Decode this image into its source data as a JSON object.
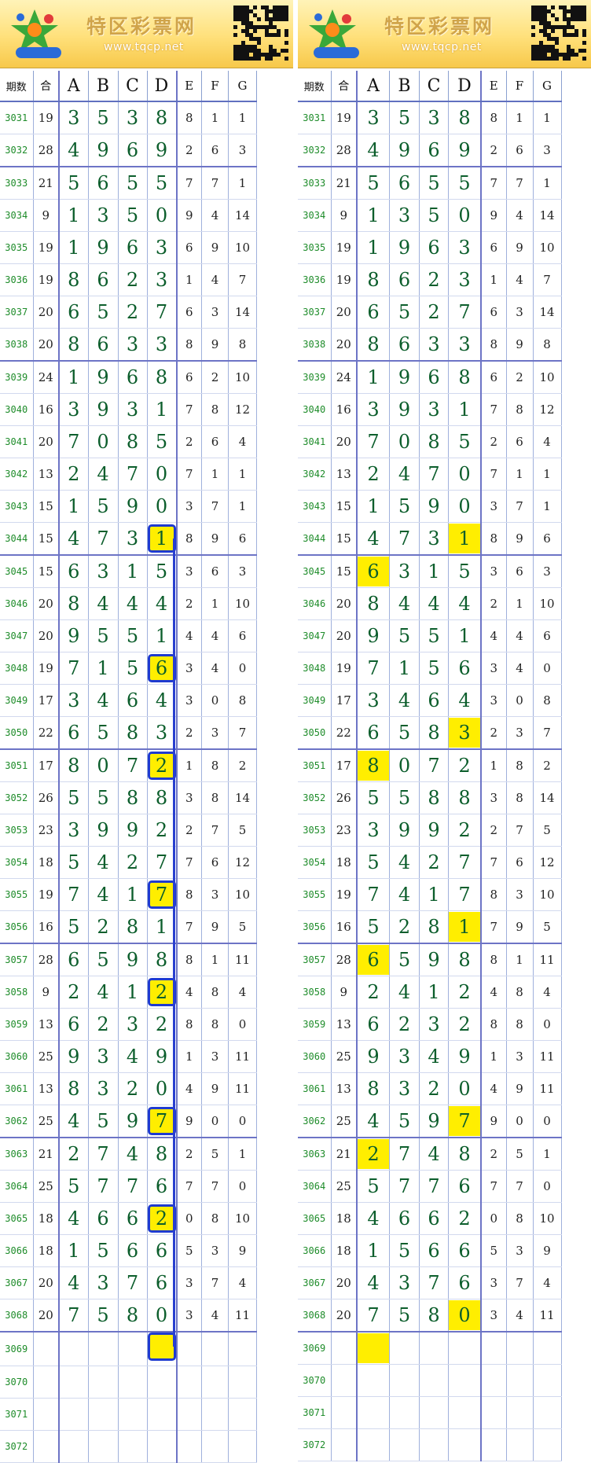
{
  "banner": {
    "brand": "特区彩票网",
    "url": "www.tqcp.net",
    "logo_icon": "seven-star-lottery-logo",
    "qr_icon": "qr-code-icon"
  },
  "headers": [
    "期数",
    "合",
    "A",
    "B",
    "C",
    "D",
    "E",
    "F",
    "G"
  ],
  "colors": {
    "highlight": "#ffee00",
    "highlight_border": "#1f3bd0",
    "digit": "#0c5e2c",
    "issue": "#1e8c2a",
    "grid": "#6d74c6"
  },
  "rows": [
    {
      "issue": "3031",
      "s": "19",
      "a": "3",
      "b": "5",
      "c": "3",
      "d": "8",
      "e": "8",
      "f": "1",
      "g": "1"
    },
    {
      "issue": "3032",
      "s": "28",
      "a": "4",
      "b": "9",
      "c": "6",
      "d": "9",
      "e": "2",
      "f": "6",
      "g": "3"
    },
    {
      "issue": "3033",
      "s": "21",
      "a": "5",
      "b": "6",
      "c": "5",
      "d": "5",
      "e": "7",
      "f": "7",
      "g": "1"
    },
    {
      "issue": "3034",
      "s": "9",
      "a": "1",
      "b": "3",
      "c": "5",
      "d": "0",
      "e": "9",
      "f": "4",
      "g": "14"
    },
    {
      "issue": "3035",
      "s": "19",
      "a": "1",
      "b": "9",
      "c": "6",
      "d": "3",
      "e": "6",
      "f": "9",
      "g": "10"
    },
    {
      "issue": "3036",
      "s": "19",
      "a": "8",
      "b": "6",
      "c": "2",
      "d": "3",
      "e": "1",
      "f": "4",
      "g": "7"
    },
    {
      "issue": "3037",
      "s": "20",
      "a": "6",
      "b": "5",
      "c": "2",
      "d": "7",
      "e": "6",
      "f": "3",
      "g": "14"
    },
    {
      "issue": "3038",
      "s": "20",
      "a": "8",
      "b": "6",
      "c": "3",
      "d": "3",
      "e": "8",
      "f": "9",
      "g": "8"
    },
    {
      "issue": "3039",
      "s": "24",
      "a": "1",
      "b": "9",
      "c": "6",
      "d": "8",
      "e": "6",
      "f": "2",
      "g": "10"
    },
    {
      "issue": "3040",
      "s": "16",
      "a": "3",
      "b": "9",
      "c": "3",
      "d": "1",
      "e": "7",
      "f": "8",
      "g": "12"
    },
    {
      "issue": "3041",
      "s": "20",
      "a": "7",
      "b": "0",
      "c": "8",
      "d": "5",
      "e": "2",
      "f": "6",
      "g": "4"
    },
    {
      "issue": "3042",
      "s": "13",
      "a": "2",
      "b": "4",
      "c": "7",
      "d": "0",
      "e": "7",
      "f": "1",
      "g": "1"
    },
    {
      "issue": "3043",
      "s": "15",
      "a": "1",
      "b": "5",
      "c": "9",
      "d": "0",
      "e": "3",
      "f": "7",
      "g": "1"
    },
    {
      "issue": "3044",
      "s": "15",
      "a": "4",
      "b": "7",
      "c": "3",
      "d": "1",
      "e": "8",
      "f": "9",
      "g": "6"
    },
    {
      "issue": "3045",
      "s": "15",
      "a": "6",
      "b": "3",
      "c": "1",
      "d": "5",
      "e": "3",
      "f": "6",
      "g": "3"
    },
    {
      "issue": "3046",
      "s": "20",
      "a": "8",
      "b": "4",
      "c": "4",
      "d": "4",
      "e": "2",
      "f": "1",
      "g": "10"
    },
    {
      "issue": "3047",
      "s": "20",
      "a": "9",
      "b": "5",
      "c": "5",
      "d": "1",
      "e": "4",
      "f": "4",
      "g": "6"
    },
    {
      "issue": "3048",
      "s": "19",
      "a": "7",
      "b": "1",
      "c": "5",
      "d": "6",
      "e": "3",
      "f": "4",
      "g": "0"
    },
    {
      "issue": "3049",
      "s": "17",
      "a": "3",
      "b": "4",
      "c": "6",
      "d": "4",
      "e": "3",
      "f": "0",
      "g": "8"
    },
    {
      "issue": "3050",
      "s": "22",
      "a": "6",
      "b": "5",
      "c": "8",
      "d": "3",
      "e": "2",
      "f": "3",
      "g": "7"
    },
    {
      "issue": "3051",
      "s": "17",
      "a": "8",
      "b": "0",
      "c": "7",
      "d": "2",
      "e": "1",
      "f": "8",
      "g": "2"
    },
    {
      "issue": "3052",
      "s": "26",
      "a": "5",
      "b": "5",
      "c": "8",
      "d": "8",
      "e": "3",
      "f": "8",
      "g": "14"
    },
    {
      "issue": "3053",
      "s": "23",
      "a": "3",
      "b": "9",
      "c": "9",
      "d": "2",
      "e": "2",
      "f": "7",
      "g": "5"
    },
    {
      "issue": "3054",
      "s": "18",
      "a": "5",
      "b": "4",
      "c": "2",
      "d": "7",
      "e": "7",
      "f": "6",
      "g": "12"
    },
    {
      "issue": "3055",
      "s": "19",
      "a": "7",
      "b": "4",
      "c": "1",
      "d": "7",
      "e": "8",
      "f": "3",
      "g": "10"
    },
    {
      "issue": "3056",
      "s": "16",
      "a": "5",
      "b": "2",
      "c": "8",
      "d": "1",
      "e": "7",
      "f": "9",
      "g": "5"
    },
    {
      "issue": "3057",
      "s": "28",
      "a": "6",
      "b": "5",
      "c": "9",
      "d": "8",
      "e": "8",
      "f": "1",
      "g": "11"
    },
    {
      "issue": "3058",
      "s": "9",
      "a": "2",
      "b": "4",
      "c": "1",
      "d": "2",
      "e": "4",
      "f": "8",
      "g": "4"
    },
    {
      "issue": "3059",
      "s": "13",
      "a": "6",
      "b": "2",
      "c": "3",
      "d": "2",
      "e": "8",
      "f": "8",
      "g": "0"
    },
    {
      "issue": "3060",
      "s": "25",
      "a": "9",
      "b": "3",
      "c": "4",
      "d": "9",
      "e": "1",
      "f": "3",
      "g": "11"
    },
    {
      "issue": "3061",
      "s": "13",
      "a": "8",
      "b": "3",
      "c": "2",
      "d": "0",
      "e": "4",
      "f": "9",
      "g": "11"
    },
    {
      "issue": "3062",
      "s": "25",
      "a": "4",
      "b": "5",
      "c": "9",
      "d": "7",
      "e": "9",
      "f": "0",
      "g": "0"
    },
    {
      "issue": "3063",
      "s": "21",
      "a": "2",
      "b": "7",
      "c": "4",
      "d": "8",
      "e": "2",
      "f": "5",
      "g": "1"
    },
    {
      "issue": "3064",
      "s": "25",
      "a": "5",
      "b": "7",
      "c": "7",
      "d": "6",
      "e": "7",
      "f": "7",
      "g": "0"
    },
    {
      "issue": "3065",
      "s": "18",
      "a": "4",
      "b": "6",
      "c": "6",
      "d": "2",
      "e": "0",
      "f": "8",
      "g": "10"
    },
    {
      "issue": "3066",
      "s": "18",
      "a": "1",
      "b": "5",
      "c": "6",
      "d": "6",
      "e": "5",
      "f": "3",
      "g": "9"
    },
    {
      "issue": "3067",
      "s": "20",
      "a": "4",
      "b": "3",
      "c": "7",
      "d": "6",
      "e": "3",
      "f": "7",
      "g": "4"
    },
    {
      "issue": "3068",
      "s": "20",
      "a": "7",
      "b": "5",
      "c": "8",
      "d": "0",
      "e": "3",
      "f": "4",
      "g": "11"
    },
    {
      "issue": "3069",
      "s": "",
      "a": "",
      "b": "",
      "c": "",
      "d": "",
      "e": "",
      "f": "",
      "g": ""
    },
    {
      "issue": "3070",
      "s": "",
      "a": "",
      "b": "",
      "c": "",
      "d": "",
      "e": "",
      "f": "",
      "g": ""
    },
    {
      "issue": "3071",
      "s": "",
      "a": "",
      "b": "",
      "c": "",
      "d": "",
      "e": "",
      "f": "",
      "g": ""
    },
    {
      "issue": "3072",
      "s": "",
      "a": "",
      "b": "",
      "c": "",
      "d": "",
      "e": "",
      "f": "",
      "g": ""
    }
  ],
  "left_marks": {
    "d": [
      "3044",
      "3048",
      "3051",
      "3055",
      "3058",
      "3062",
      "3065",
      "3069"
    ]
  },
  "right_marks": {
    "a": [
      "3045",
      "3051",
      "3057",
      "3063",
      "3069"
    ],
    "d": [
      "3044",
      "3050",
      "3056",
      "3062",
      "3068"
    ]
  }
}
